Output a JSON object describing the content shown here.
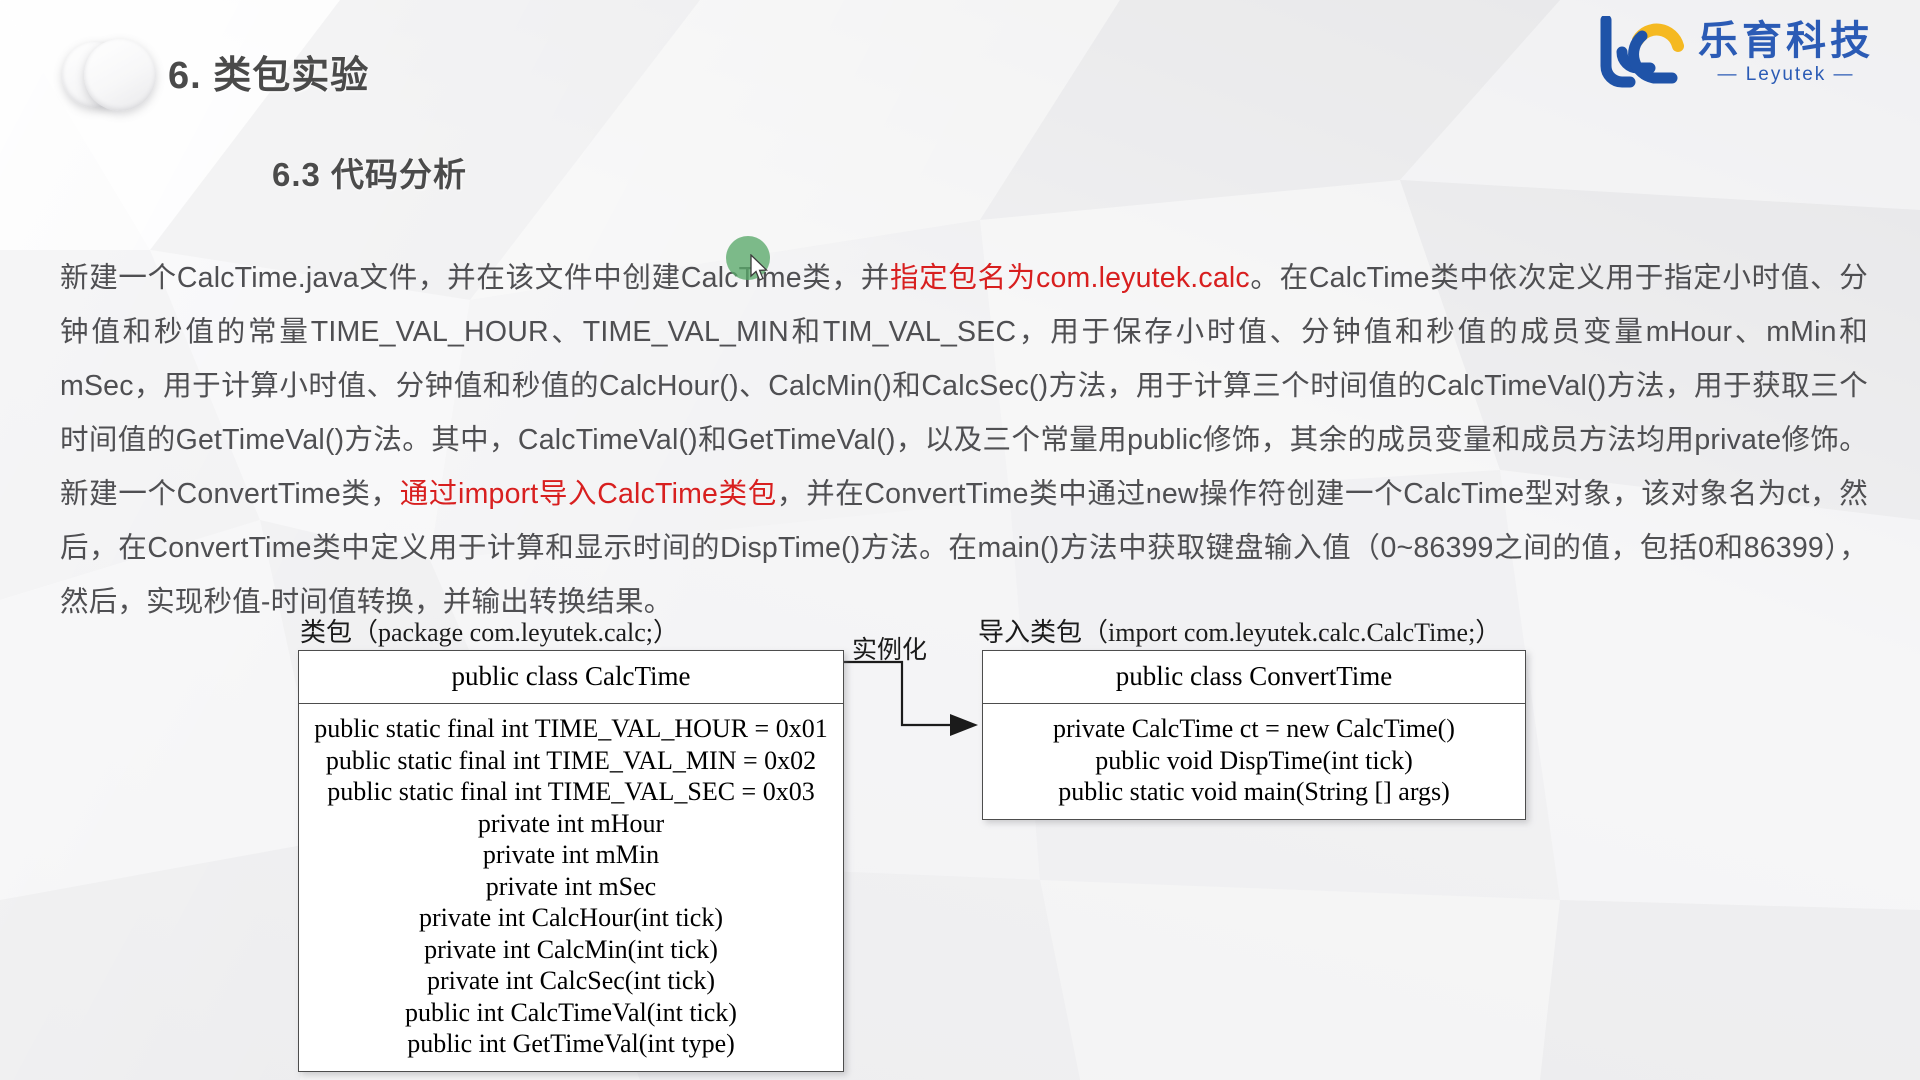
{
  "header": {
    "section_number_title": "6. 类包实验",
    "subsection_title": "6.3 代码分析"
  },
  "logo": {
    "cn_name": "乐育科技",
    "en_name": "— Leyutek —",
    "mark_blue": "#1f53a8",
    "mark_yellow": "#f5b921",
    "text_color": "#2b5bb5"
  },
  "body": {
    "segments": [
      {
        "text": "    新建一个CalcTime.java文件，并在该文件中创建CalcTime类，并",
        "highlight": false
      },
      {
        "text": "指定包名为com.leyutek.calc",
        "highlight": true
      },
      {
        "text": "。在CalcTime类中依次定义用于指定小时值、分钟值和秒值的常量TIME_VAL_HOUR、TIME_VAL_MIN和TIM_VAL_SEC，用于保存小时值、分钟值和秒值的成员变量mHour、mMin和mSec，用于计算小时值、分钟值和秒值的CalcHour()、CalcMin()和CalcSec()方法，用于计算三个时间值的CalcTimeVal()方法，用于获取三个时间值的GetTimeVal()方法。其中，CalcTimeVal()和GetTimeVal()，以及三个常量用public修饰，其余的成员变量和成员方法均用private修饰。新建一个ConvertTime类，",
        "highlight": false
      },
      {
        "text": "通过import导入CalcTime类包",
        "highlight": true
      },
      {
        "text": "，并在ConvertTime类中通过new操作符创建一个CalcTime型对象，该对象名为ct，然后，在ConvertTime类中定义用于计算和显示时间的DispTime()方法。在main()方法中获取键盘输入值（0~86399之间的值，包括0和86399），然后，实现秒值-时间值转换，并输出转换结果。",
        "highlight": false
      }
    ],
    "highlight_color": "#d81f1f",
    "text_color": "#4f4f52"
  },
  "diagram": {
    "left_caption": "类包（package com.leyutek.calc;）",
    "right_caption": "导入类包（import com.leyutek.calc.CalcTime;）",
    "relation_label": "实例化",
    "left_class": {
      "title": "public class CalcTime",
      "members": [
        "public static final int TIME_VAL_HOUR = 0x01",
        "public static final int TIME_VAL_MIN  = 0x02",
        "public static final int TIME_VAL_SEC  = 0x03",
        "private int mHour",
        "private int mMin",
        "private int mSec",
        "private int CalcHour(int tick)",
        "private int CalcMin(int tick)",
        "private int CalcSec(int tick)",
        "public int CalcTimeVal(int tick)",
        "public int GetTimeVal(int type)"
      ]
    },
    "right_class": {
      "title": "public class ConvertTime",
      "members": [
        "private CalcTime ct = new CalcTime()",
        "public void DispTime(int tick)",
        "public static void main(String [] args)"
      ]
    }
  },
  "cursor": {
    "icon": "mouse-pointer-icon",
    "halo_color": "#5aa96a"
  }
}
